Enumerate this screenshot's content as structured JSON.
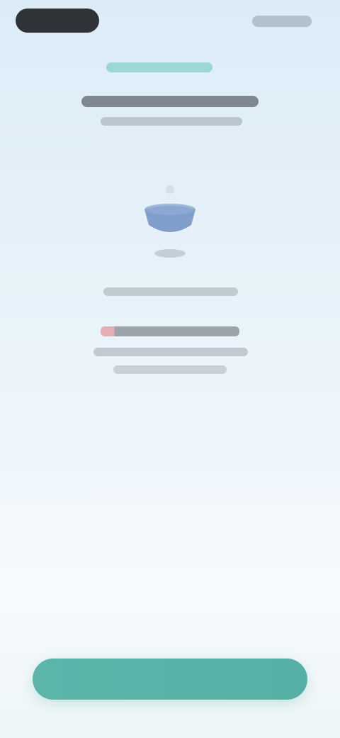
{
  "screen": {
    "background_top": "#dcecf7",
    "background_bottom": "#f6fafc"
  },
  "header": {
    "back_label": "",
    "action_label": ""
  },
  "content": {
    "eyebrow": "",
    "title": "",
    "subtitle": "",
    "illustration_icon": "bowl-icon",
    "illustration_caption": "",
    "body": []
  },
  "footer": {
    "button_label": ""
  },
  "colors": {
    "accent": "#5cb5a9",
    "eyebrow": "#7fcfc0",
    "illustration": "#6f8fc2",
    "highlight": "#e0757a"
  }
}
